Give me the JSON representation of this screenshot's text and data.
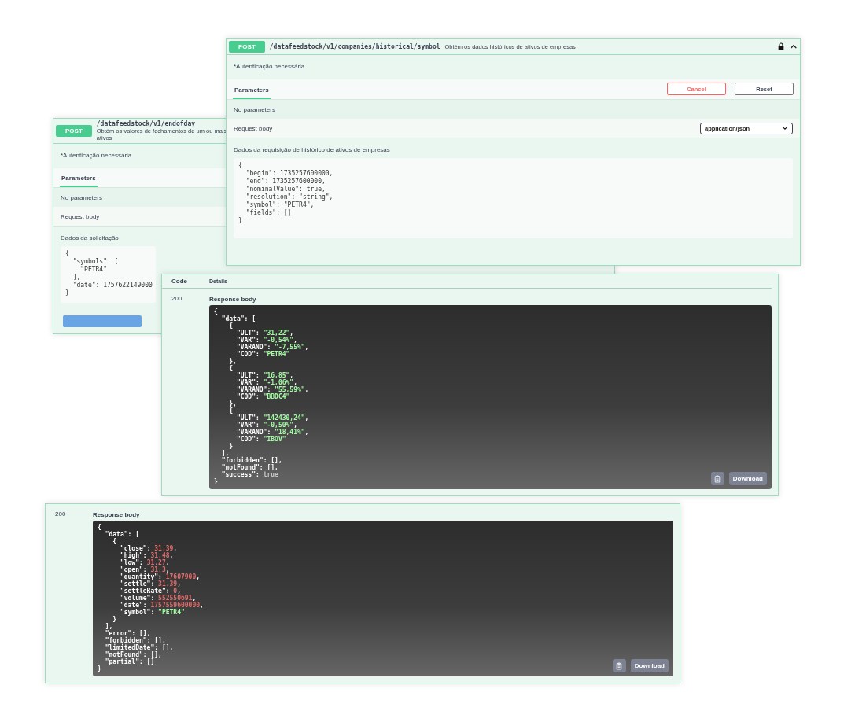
{
  "endofday_panel": {
    "method": "POST",
    "path": "/datafeedstock/v1/endofday",
    "description": "Obtém os valores de fechamentos de um ou mais ativos",
    "auth_note": "*Autenticação necessária",
    "tabs": [
      {
        "label": "Parameters",
        "selected": true
      }
    ],
    "no_parameters": "No parameters",
    "request_body_label": "Request body",
    "body_title": "Dados da solicitação",
    "body_code": [
      "{",
      "  \"symbols\": [",
      "    \"PETR4\"",
      "  ],",
      "  \"date\": 1757622149000",
      "}"
    ]
  },
  "historical_panel": {
    "method": "POST",
    "path": "/datafeedstock/v1/companies/historical/symbol",
    "description": "Obtém os dados históricos de ativos de empresas",
    "auth_note": "*Autenticação necessária",
    "tabs": [
      {
        "label": "Parameters",
        "selected": true
      }
    ],
    "cancel_button": "Cancel",
    "reset_button": "Reset",
    "no_parameters": "No parameters",
    "request_body_label": "Request body",
    "content_type": "application/json",
    "body_title": "Dados da requisição de histórico de ativos de empresas",
    "body_code": [
      "{",
      "  \"begin\": 1735257600000,",
      "  \"end\": 1735257600000,",
      "  \"nominalValue\": true,",
      "  \"resolution\": \"string\",",
      "  \"symbol\": \"PETR4\",",
      "  \"fields\": []",
      "}"
    ]
  },
  "quotes_response": {
    "code_header": "Code",
    "details_header": "Details",
    "status_code": "200",
    "body_label": "Response body",
    "download_button": "Download",
    "lines": [
      [
        {
          "text": "{",
          "kind": "punct"
        }
      ],
      [
        {
          "text": "  \"data\"",
          "kind": "key"
        },
        {
          "text": ": [",
          "kind": "punct"
        }
      ],
      [
        {
          "text": "    {",
          "kind": "punct"
        }
      ],
      [
        {
          "text": "      \"ULT\"",
          "kind": "key"
        },
        {
          "text": ": ",
          "kind": "punct"
        },
        {
          "text": "\"31,22\"",
          "kind": "string"
        },
        {
          "text": ",",
          "kind": "punct"
        }
      ],
      [
        {
          "text": "      \"VAR\"",
          "kind": "key"
        },
        {
          "text": ": ",
          "kind": "punct"
        },
        {
          "text": "\"-0,54%\"",
          "kind": "string"
        },
        {
          "text": ",",
          "kind": "punct"
        }
      ],
      [
        {
          "text": "      \"VARANO\"",
          "kind": "key"
        },
        {
          "text": ": ",
          "kind": "punct"
        },
        {
          "text": "\"-7,55%\"",
          "kind": "string"
        },
        {
          "text": ",",
          "kind": "punct"
        }
      ],
      [
        {
          "text": "      \"COD\"",
          "kind": "key"
        },
        {
          "text": ": ",
          "kind": "punct"
        },
        {
          "text": "\"PETR4\"",
          "kind": "string"
        }
      ],
      [
        {
          "text": "    },",
          "kind": "punct"
        }
      ],
      [
        {
          "text": "    {",
          "kind": "punct"
        }
      ],
      [
        {
          "text": "      \"ULT\"",
          "kind": "key"
        },
        {
          "text": ": ",
          "kind": "punct"
        },
        {
          "text": "\"16,85\"",
          "kind": "string"
        },
        {
          "text": ",",
          "kind": "punct"
        }
      ],
      [
        {
          "text": "      \"VAR\"",
          "kind": "key"
        },
        {
          "text": ": ",
          "kind": "punct"
        },
        {
          "text": "\"-1,06%\"",
          "kind": "string"
        },
        {
          "text": ",",
          "kind": "punct"
        }
      ],
      [
        {
          "text": "      \"VARANO\"",
          "kind": "key"
        },
        {
          "text": ": ",
          "kind": "punct"
        },
        {
          "text": "\"55,59%\"",
          "kind": "string"
        },
        {
          "text": ",",
          "kind": "punct"
        }
      ],
      [
        {
          "text": "      \"COD\"",
          "kind": "key"
        },
        {
          "text": ": ",
          "kind": "punct"
        },
        {
          "text": "\"BBDC4\"",
          "kind": "string"
        }
      ],
      [
        {
          "text": "    },",
          "kind": "punct"
        }
      ],
      [
        {
          "text": "    {",
          "kind": "punct"
        }
      ],
      [
        {
          "text": "      \"ULT\"",
          "kind": "key"
        },
        {
          "text": ": ",
          "kind": "punct"
        },
        {
          "text": "\"142430,24\"",
          "kind": "string"
        },
        {
          "text": ",",
          "kind": "punct"
        }
      ],
      [
        {
          "text": "      \"VAR\"",
          "kind": "key"
        },
        {
          "text": ": ",
          "kind": "punct"
        },
        {
          "text": "\"-0,50%\"",
          "kind": "string"
        },
        {
          "text": ",",
          "kind": "punct"
        }
      ],
      [
        {
          "text": "      \"VARANO\"",
          "kind": "key"
        },
        {
          "text": ": ",
          "kind": "punct"
        },
        {
          "text": "\"18,41%\"",
          "kind": "string"
        },
        {
          "text": ",",
          "kind": "punct"
        }
      ],
      [
        {
          "text": "      \"COD\"",
          "kind": "key"
        },
        {
          "text": ": ",
          "kind": "punct"
        },
        {
          "text": "\"IBOV\"",
          "kind": "string"
        }
      ],
      [
        {
          "text": "    }",
          "kind": "punct"
        }
      ],
      [
        {
          "text": "  ],",
          "kind": "punct"
        }
      ],
      [
        {
          "text": "  \"forbidden\"",
          "kind": "key"
        },
        {
          "text": ": [],",
          "kind": "punct"
        }
      ],
      [
        {
          "text": "  \"notFound\"",
          "kind": "key"
        },
        {
          "text": ": [],",
          "kind": "punct"
        }
      ],
      [
        {
          "text": "  \"success\"",
          "kind": "key"
        },
        {
          "text": ": ",
          "kind": "punct"
        },
        {
          "text": "true",
          "kind": "plain"
        }
      ],
      [
        {
          "text": "}",
          "kind": "punct"
        }
      ]
    ]
  },
  "endofday_response": {
    "status_code": "200",
    "body_label": "Response body",
    "download_button": "Download",
    "lines": [
      [
        {
          "text": "{",
          "kind": "punct"
        }
      ],
      [
        {
          "text": "  \"data\"",
          "kind": "key"
        },
        {
          "text": ": [",
          "kind": "punct"
        }
      ],
      [
        {
          "text": "    {",
          "kind": "punct"
        }
      ],
      [
        {
          "text": "      \"close\"",
          "kind": "key"
        },
        {
          "text": ": ",
          "kind": "punct"
        },
        {
          "text": "31.39",
          "kind": "number"
        },
        {
          "text": ",",
          "kind": "punct"
        }
      ],
      [
        {
          "text": "      \"high\"",
          "kind": "key"
        },
        {
          "text": ": ",
          "kind": "punct"
        },
        {
          "text": "31.48",
          "kind": "number"
        },
        {
          "text": ",",
          "kind": "punct"
        }
      ],
      [
        {
          "text": "      \"low\"",
          "kind": "key"
        },
        {
          "text": ": ",
          "kind": "punct"
        },
        {
          "text": "31.27",
          "kind": "number"
        },
        {
          "text": ",",
          "kind": "punct"
        }
      ],
      [
        {
          "text": "      \"open\"",
          "kind": "key"
        },
        {
          "text": ": ",
          "kind": "punct"
        },
        {
          "text": "31.3",
          "kind": "number"
        },
        {
          "text": ",",
          "kind": "punct"
        }
      ],
      [
        {
          "text": "      \"quantity\"",
          "kind": "key"
        },
        {
          "text": ": ",
          "kind": "punct"
        },
        {
          "text": "17607900",
          "kind": "number"
        },
        {
          "text": ",",
          "kind": "punct"
        }
      ],
      [
        {
          "text": "      \"settle\"",
          "kind": "key"
        },
        {
          "text": ": ",
          "kind": "punct"
        },
        {
          "text": "31.39",
          "kind": "number"
        },
        {
          "text": ",",
          "kind": "punct"
        }
      ],
      [
        {
          "text": "      \"settleRate\"",
          "kind": "key"
        },
        {
          "text": ": ",
          "kind": "punct"
        },
        {
          "text": "0",
          "kind": "number"
        },
        {
          "text": ",",
          "kind": "punct"
        }
      ],
      [
        {
          "text": "      \"volume\"",
          "kind": "key"
        },
        {
          "text": ": ",
          "kind": "punct"
        },
        {
          "text": "552550691",
          "kind": "number"
        },
        {
          "text": ",",
          "kind": "punct"
        }
      ],
      [
        {
          "text": "      \"date\"",
          "kind": "key"
        },
        {
          "text": ": ",
          "kind": "punct"
        },
        {
          "text": "1757559600000",
          "kind": "number"
        },
        {
          "text": ",",
          "kind": "punct"
        }
      ],
      [
        {
          "text": "      \"symbol\"",
          "kind": "key"
        },
        {
          "text": ": ",
          "kind": "punct"
        },
        {
          "text": "\"PETR4\"",
          "kind": "string"
        }
      ],
      [
        {
          "text": "    }",
          "kind": "punct"
        }
      ],
      [
        {
          "text": "  ],",
          "kind": "punct"
        }
      ],
      [
        {
          "text": "  \"error\"",
          "kind": "key"
        },
        {
          "text": ": [],",
          "kind": "punct"
        }
      ],
      [
        {
          "text": "  \"forbidden\"",
          "kind": "key"
        },
        {
          "text": ": [],",
          "kind": "punct"
        }
      ],
      [
        {
          "text": "  \"limitedDate\"",
          "kind": "key"
        },
        {
          "text": ": [],",
          "kind": "punct"
        }
      ],
      [
        {
          "text": "  \"notFound\"",
          "kind": "key"
        },
        {
          "text": ": [],",
          "kind": "punct"
        }
      ],
      [
        {
          "text": "  \"partial\"",
          "kind": "key"
        },
        {
          "text": ": []",
          "kind": "punct"
        }
      ],
      [
        {
          "text": "}",
          "kind": "punct"
        }
      ]
    ]
  }
}
